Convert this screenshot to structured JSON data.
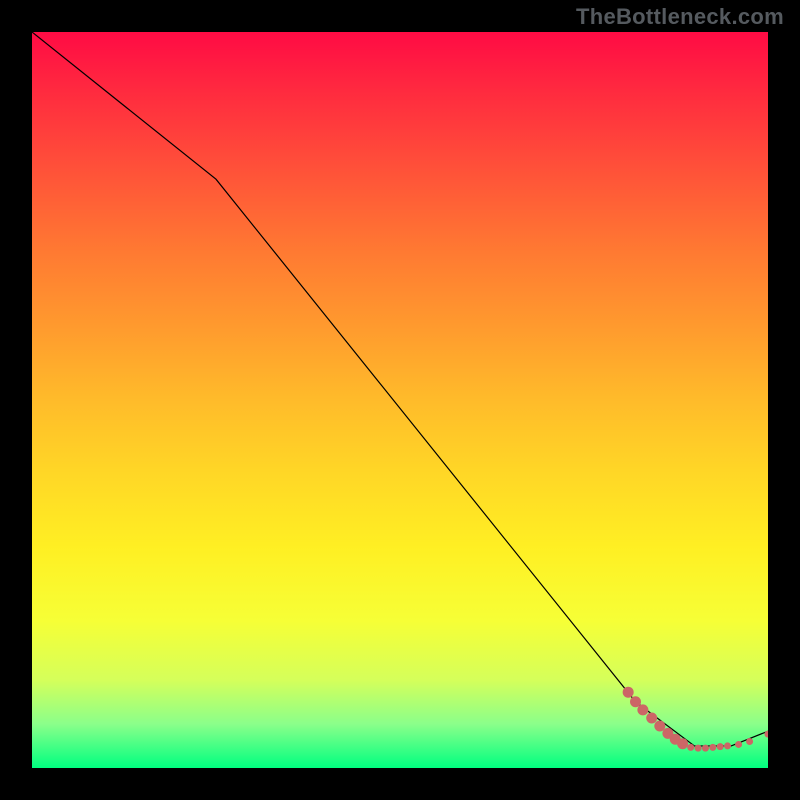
{
  "watermark": "TheBottleneck.com",
  "chart_data": {
    "type": "line",
    "title": "",
    "xlabel": "",
    "ylabel": "",
    "xlim": [
      0,
      100
    ],
    "ylim": [
      0,
      100
    ],
    "series": [
      {
        "name": "bottleneck-curve",
        "x": [
          0,
          25,
          82,
          90,
          95,
          100
        ],
        "values": [
          100,
          80,
          9,
          3,
          3,
          5
        ],
        "stroke": "#000000",
        "width": 1.2
      }
    ],
    "markers": {
      "name": "low-bottleneck-markers",
      "color": "#cc6666",
      "radius_small": 3.5,
      "radius_large": 5.5,
      "points": [
        {
          "x": 81.0,
          "y": 10.3,
          "r": "large"
        },
        {
          "x": 82.0,
          "y": 9.0,
          "r": "large"
        },
        {
          "x": 83.0,
          "y": 7.9,
          "r": "large"
        },
        {
          "x": 84.2,
          "y": 6.8,
          "r": "large"
        },
        {
          "x": 85.3,
          "y": 5.7,
          "r": "large"
        },
        {
          "x": 86.4,
          "y": 4.7,
          "r": "large"
        },
        {
          "x": 87.4,
          "y": 3.9,
          "r": "large"
        },
        {
          "x": 88.4,
          "y": 3.3,
          "r": "large"
        },
        {
          "x": 89.5,
          "y": 2.8,
          "r": "small"
        },
        {
          "x": 90.5,
          "y": 2.7,
          "r": "small"
        },
        {
          "x": 91.5,
          "y": 2.7,
          "r": "small"
        },
        {
          "x": 92.5,
          "y": 2.8,
          "r": "small"
        },
        {
          "x": 93.5,
          "y": 2.9,
          "r": "small"
        },
        {
          "x": 94.5,
          "y": 3.0,
          "r": "small"
        },
        {
          "x": 96.0,
          "y": 3.2,
          "r": "small"
        },
        {
          "x": 97.5,
          "y": 3.6,
          "r": "small"
        },
        {
          "x": 100.0,
          "y": 4.6,
          "r": "small"
        }
      ]
    },
    "background": {
      "gradient_stops": [
        {
          "pos": 0.0,
          "color": "#ff0b44"
        },
        {
          "pos": 0.5,
          "color": "#ffbb2a"
        },
        {
          "pos": 0.8,
          "color": "#f6ff36"
        },
        {
          "pos": 1.0,
          "color": "#00ff80"
        }
      ]
    }
  }
}
